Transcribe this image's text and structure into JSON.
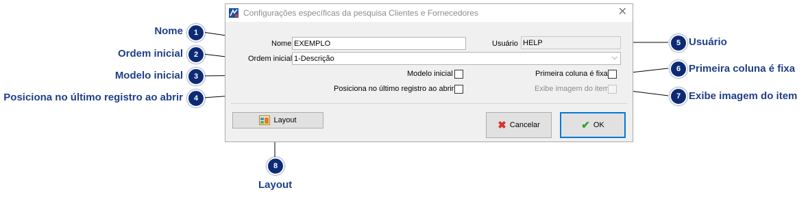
{
  "dialog": {
    "title": "Configurações específicas da pesquisa Clientes e Fornecedores",
    "nome_label": "Nome",
    "nome_value": "EXEMPLO",
    "usuario_label": "Usuário",
    "usuario_value": "HELP",
    "ordem_label": "Ordem inicial",
    "ordem_value": "1-Descrição",
    "modelo_label": "Modelo inicial",
    "primeira_label": "Primeira coluna é fixa",
    "posiciona_label": "Posiciona no último registro ao abrir",
    "exibe_label": "Exibe imagem do item",
    "layout_button": "Layout",
    "cancel_button": "Cancelar",
    "ok_button": "OK"
  },
  "callouts": [
    {
      "num": "1",
      "text": "Nome"
    },
    {
      "num": "2",
      "text": "Ordem inicial"
    },
    {
      "num": "3",
      "text": "Modelo inicial"
    },
    {
      "num": "4",
      "text": "Posiciona no último registro ao abrir"
    },
    {
      "num": "5",
      "text": "Usuário"
    },
    {
      "num": "6",
      "text": "Primeira coluna é fixa"
    },
    {
      "num": "7",
      "text": "Exibe imagem do item"
    },
    {
      "num": "8",
      "text": "Layout"
    }
  ],
  "colors": {
    "callout_badge": "#0d2a74",
    "callout_text": "#1f3f86",
    "ok_border": "#0078d7",
    "cancel_icon": "#d9342b",
    "ok_icon": "#2e9b2e"
  }
}
